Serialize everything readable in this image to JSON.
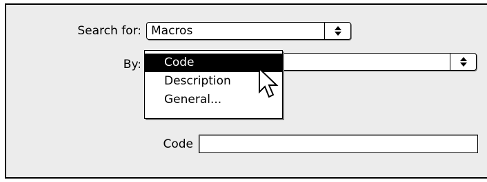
{
  "form": {
    "search_for_label": "Search for:",
    "search_for_value": "Macros",
    "by_label": "By:",
    "by_value": "",
    "code_label": "Code",
    "code_value": ""
  },
  "by_menu": {
    "items": [
      "Code",
      "Description",
      "General..."
    ],
    "selected": "Code"
  },
  "icons": {
    "popup_arrows": "up-down-arrows-icon",
    "pointer": "arrow-pointer-icon"
  }
}
